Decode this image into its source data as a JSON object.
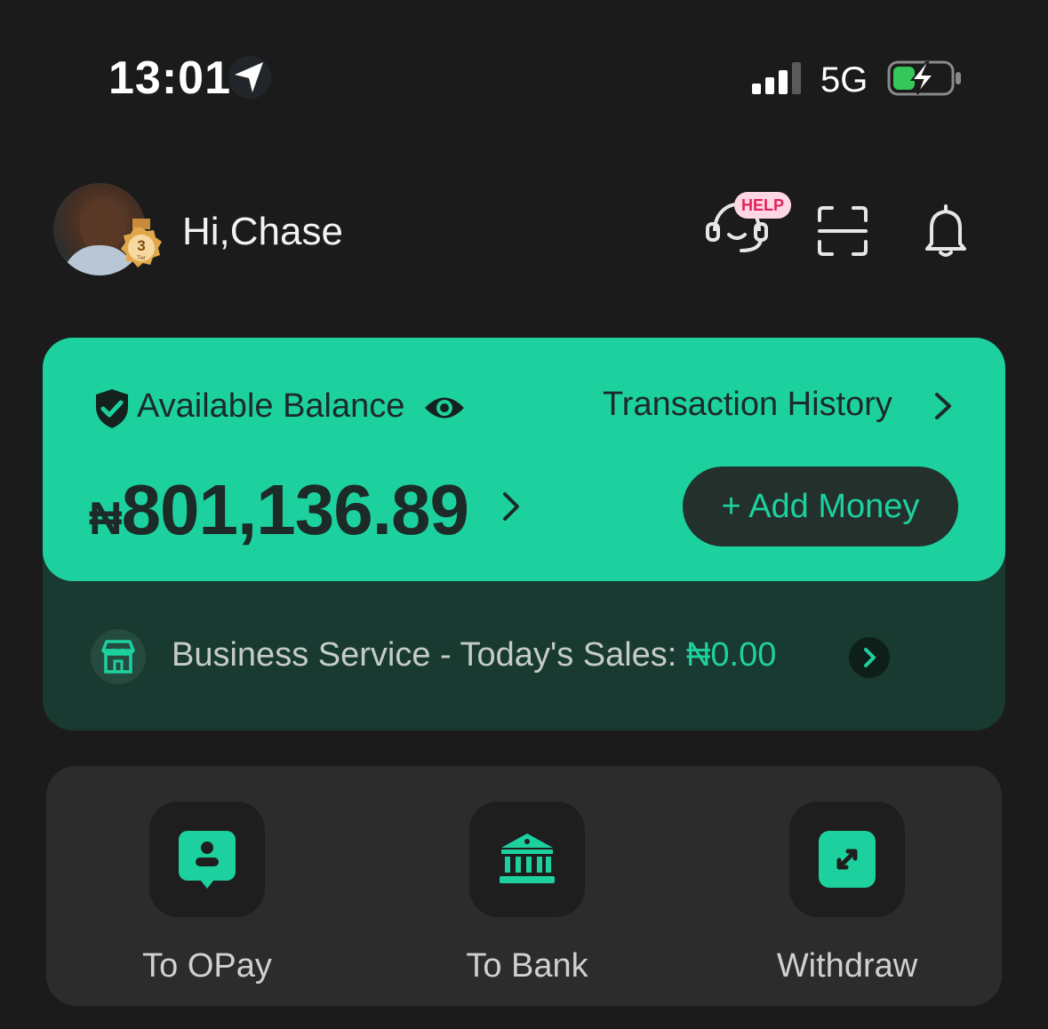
{
  "status_bar": {
    "time": "13:01",
    "network": "5G",
    "icons": [
      "location-arrow-icon",
      "signal-icon",
      "battery-charging-icon"
    ]
  },
  "header": {
    "greeting": "Hi,Chase",
    "tier_number": "3",
    "tier_label": "Tier",
    "help_badge": "HELP",
    "icons": [
      "headset-help-icon",
      "scan-icon",
      "bell-icon"
    ]
  },
  "balance": {
    "label": "Available Balance",
    "history_link": "Transaction History",
    "currency": "₦",
    "amount": "801,136.89",
    "add_money_label": "+ Add Money"
  },
  "business": {
    "text": "Business Service - Today's Sales: ",
    "amount": "₦0.00"
  },
  "actions": [
    {
      "label": "To OPay",
      "icon": "user-chat-icon"
    },
    {
      "label": "To Bank",
      "icon": "bank-icon"
    },
    {
      "label": "Withdraw",
      "icon": "withdraw-arrows-icon"
    }
  ],
  "colors": {
    "background": "#1b1b1b",
    "accent": "#1dd19f",
    "card_dark": "#193a30",
    "panel": "#2c2c2c",
    "help_pink": "#e0225c"
  }
}
